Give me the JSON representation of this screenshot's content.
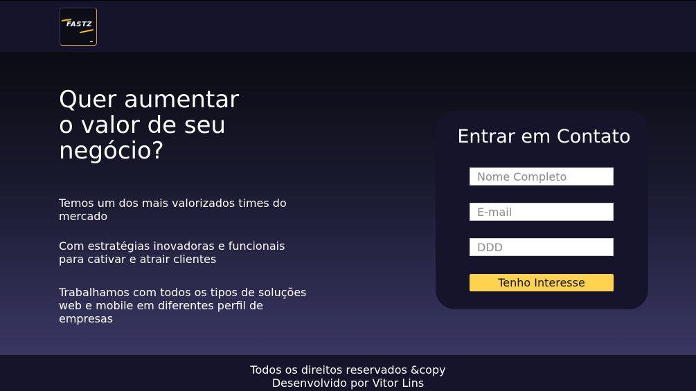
{
  "brand": {
    "logo_text": "FASTZ"
  },
  "hero": {
    "headline_lines": [
      "Quer aumentar",
      "o valor de seu",
      "negócio?"
    ],
    "features": [
      "Temos um dos mais valorizados times do mercado",
      "Com estratégias inovadoras e funcionais para cativar e atrair clientes",
      "Trabalhamos com todos os tipos de soluções web e mobile em diferentes perfil de empresas"
    ]
  },
  "contact": {
    "title": "Entrar em Contato",
    "name_placeholder": "Nome Completo",
    "email_placeholder": "E-mail",
    "ddd_placeholder": "DDD",
    "submit_label": "Tenho Interesse"
  },
  "footer": {
    "rights": "Todos os direitos reservados &copy",
    "developer": "Desenvolvido por Vitor Lins"
  },
  "colors": {
    "header_bg": "#15142b",
    "card_bg": "#15142b",
    "button_bg": "#ffd24f",
    "logo_accent": "#f1c40f"
  }
}
